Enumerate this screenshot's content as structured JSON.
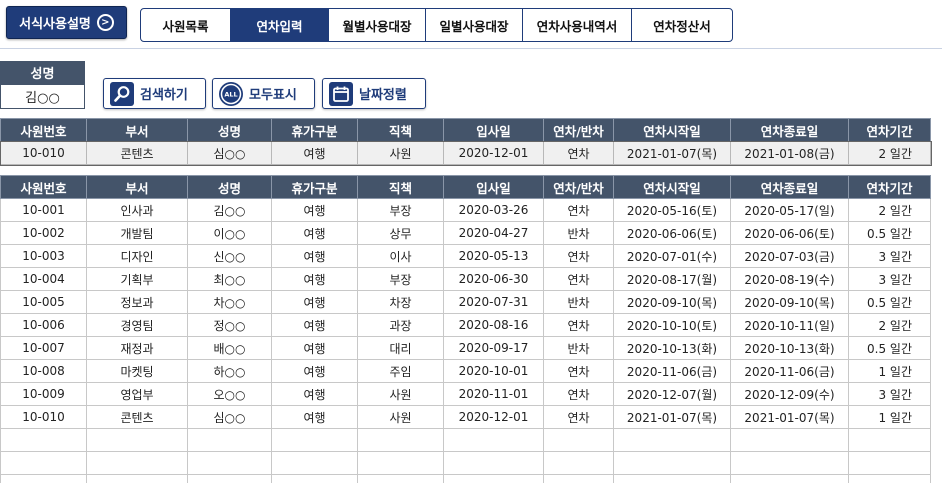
{
  "guide_button": {
    "label": "서식사용설명",
    "icon": ">"
  },
  "tabs": [
    {
      "label": "사원목록",
      "active": false
    },
    {
      "label": "연차입력",
      "active": true
    },
    {
      "label": "월별사용대장",
      "active": false
    },
    {
      "label": "일별사용대장",
      "active": false
    },
    {
      "label": "연차사용내역서",
      "active": false
    },
    {
      "label": "연차정산서",
      "active": false
    }
  ],
  "search": {
    "name_label": "성명",
    "name_value": "김○○",
    "buttons": [
      {
        "label": "검색하기",
        "icon": "search-icon"
      },
      {
        "label": "모두표시",
        "icon": "all-icon",
        "icon_text": "ALL"
      },
      {
        "label": "날짜정렬",
        "icon": "calendar-icon"
      }
    ]
  },
  "columns": [
    "사원번호",
    "부서",
    "성명",
    "휴가구분",
    "직책",
    "입사일",
    "연차/반차",
    "연차시작일",
    "연차종료일",
    "연차기간"
  ],
  "input_row": [
    "10-010",
    "콘텐츠",
    "심○○",
    "여행",
    "사원",
    "2020-12-01",
    "연차",
    "2021-01-07(목)",
    "2021-01-08(금)",
    "2 일간"
  ],
  "rows": [
    [
      "10-001",
      "인사과",
      "김○○",
      "여행",
      "부장",
      "2020-03-26",
      "연차",
      "2020-05-16(토)",
      "2020-05-17(일)",
      "2 일간"
    ],
    [
      "10-002",
      "개발팀",
      "이○○",
      "여행",
      "상무",
      "2020-04-27",
      "반차",
      "2020-06-06(토)",
      "2020-06-06(토)",
      "0.5 일간"
    ],
    [
      "10-003",
      "디자인",
      "신○○",
      "여행",
      "이사",
      "2020-05-13",
      "연차",
      "2020-07-01(수)",
      "2020-07-03(금)",
      "3 일간"
    ],
    [
      "10-004",
      "기획부",
      "최○○",
      "여행",
      "부장",
      "2020-06-30",
      "연차",
      "2020-08-17(월)",
      "2020-08-19(수)",
      "3 일간"
    ],
    [
      "10-005",
      "정보과",
      "차○○",
      "여행",
      "차장",
      "2020-07-31",
      "반차",
      "2020-09-10(목)",
      "2020-09-10(목)",
      "0.5 일간"
    ],
    [
      "10-006",
      "경영팀",
      "정○○",
      "여행",
      "과장",
      "2020-08-16",
      "연차",
      "2020-10-10(토)",
      "2020-10-11(일)",
      "2 일간"
    ],
    [
      "10-007",
      "재정과",
      "배○○",
      "여행",
      "대리",
      "2020-09-17",
      "반차",
      "2020-10-13(화)",
      "2020-10-13(화)",
      "0.5 일간"
    ],
    [
      "10-008",
      "마켓팅",
      "하○○",
      "여행",
      "주임",
      "2020-10-01",
      "연차",
      "2020-11-06(금)",
      "2020-11-06(금)",
      "1 일간"
    ],
    [
      "10-009",
      "영업부",
      "오○○",
      "여행",
      "사원",
      "2020-11-01",
      "연차",
      "2020-12-07(월)",
      "2020-12-09(수)",
      "3 일간"
    ],
    [
      "10-010",
      "콘텐츠",
      "심○○",
      "여행",
      "사원",
      "2020-12-01",
      "연차",
      "2021-01-07(목)",
      "2021-01-07(목)",
      "1 일간"
    ]
  ],
  "empty_rows": 3,
  "colors": {
    "navy": "#1f3c7a",
    "header_bg": "#44546a",
    "selected_row": "#f0f0f0"
  }
}
